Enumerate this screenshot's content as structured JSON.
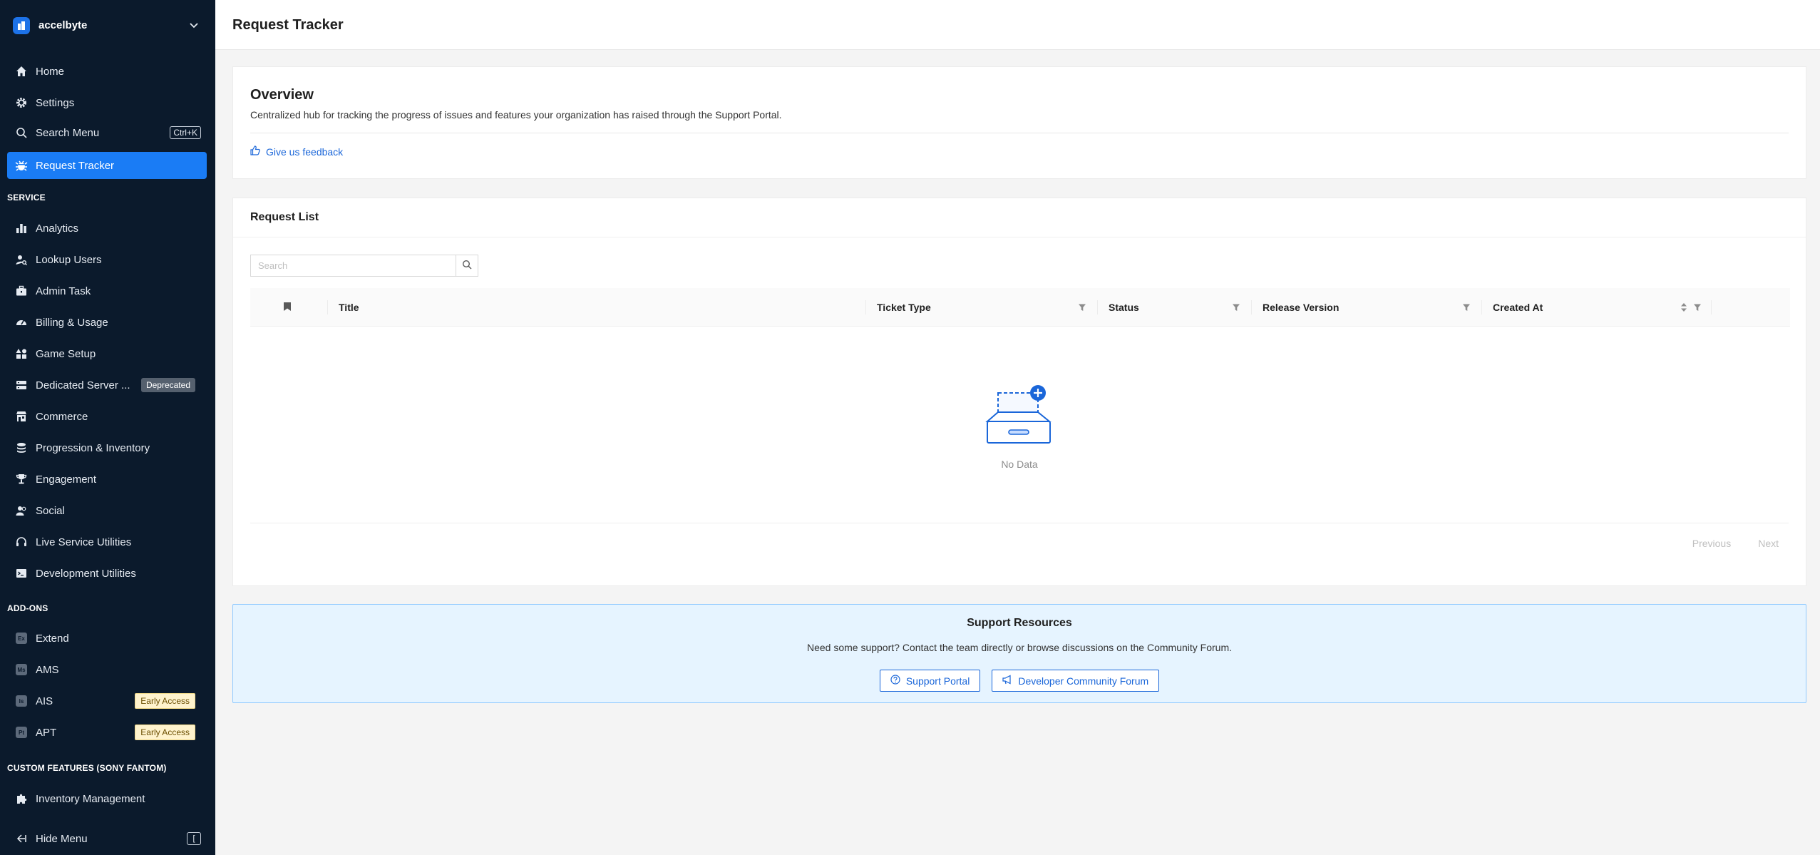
{
  "org": {
    "name": "accelbyte"
  },
  "nav": {
    "home": "Home",
    "settings": "Settings",
    "search_menu": "Search Menu",
    "search_shortcut": "Ctrl+K",
    "request_tracker": "Request Tracker"
  },
  "sections": {
    "service": "SERVICE",
    "addons": "ADD-ONS",
    "custom": "CUSTOM FEATURES (SONY FANTOM)"
  },
  "service_items": {
    "analytics": "Analytics",
    "lookup_users": "Lookup Users",
    "admin_task": "Admin Task",
    "billing": "Billing & Usage",
    "game_setup": "Game Setup",
    "dedicated_server": "Dedicated Server ...",
    "dedicated_badge": "Deprecated",
    "commerce": "Commerce",
    "progression": "Progression & Inventory",
    "engagement": "Engagement",
    "social": "Social",
    "live_service": "Live Service Utilities",
    "dev_utilities": "Development Utilities"
  },
  "addon_items": {
    "extend": "Extend",
    "ams": "AMS",
    "ais": "AIS",
    "ais_badge": "Early Access",
    "apt": "APT",
    "apt_badge": "Early Access"
  },
  "custom_items": {
    "inventory": "Inventory Management"
  },
  "hide_menu": {
    "label": "Hide Menu",
    "key": "["
  },
  "header": {
    "title": "Request Tracker"
  },
  "overview": {
    "title": "Overview",
    "description": "Centralized hub for tracking the progress of issues and features your organization has raised through the Support Portal.",
    "feedback": "Give us feedback"
  },
  "request_list": {
    "title": "Request List",
    "search_placeholder": "Search",
    "columns": {
      "title": "Title",
      "ticket_type": "Ticket Type",
      "status": "Status",
      "release_version": "Release Version",
      "created_at": "Created At"
    },
    "empty": "No Data",
    "pager": {
      "previous": "Previous",
      "next": "Next"
    }
  },
  "support": {
    "title": "Support Resources",
    "description": "Need some support? Contact the team directly or browse discussions on the Community Forum.",
    "portal_button": "Support Portal",
    "forum_button": "Developer Community Forum"
  },
  "colors": {
    "sidebar_bg": "#0b1a2c",
    "accent": "#1a7cf5",
    "link": "#1a66d9"
  }
}
